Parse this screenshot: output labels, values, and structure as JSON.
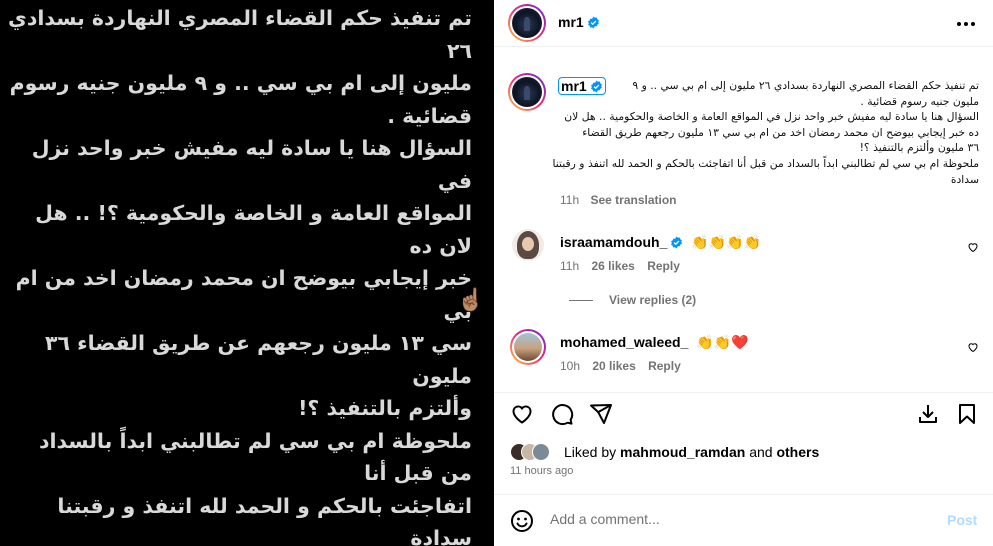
{
  "media": {
    "text": "تم تنفيذ حكم القضاء المصري النهاردة بسدادي ٢٦\nمليون إلى ام بي سي .. و ٩ مليون جنيه رسوم قضائية .\nالسؤال هنا يا سادة ليه مفيش خبر واحد نزل في\nالمواقع العامة و الخاصة والحكومية ؟! .. هل لان ده\nخبر إيجابي بيوضح ان محمد رمضان اخد من ام بي\nسي ١٣ مليون رجعهم عن  طريق القضاء ٣٦ مليون\nوألتزم بالتنفيذ ؟!\nملحوظة ام بي سي لم تطالبني ابداً بالسداد من قبل أنا\nاتفاجئت بالحكم و الحمد لله اتنفذ و رقبتنا سدادة",
    "emoji": "😎 ☝🏽"
  },
  "header": {
    "username": "mr1",
    "more_icon": "more-horizontal-icon"
  },
  "caption": {
    "username": "mr1",
    "text": "تم تنفيذ حكم القضاء المصري النهاردة بسدادي ٢٦ مليون إلى ام بي سي .. و ٩\nمليون جنيه رسوم قضائية .\nالسؤال هنا يا سادة ليه مفيش خبر واحد نزل في المواقع العامة و الخاصة والحكومية .. هل لان\nده خبر إيجابي بيوضح ان محمد رمضان اخد من ام بي سي ١٣ مليون رجعهم طريق القضاء\n٣٦ مليون وألتزم بالتنفيذ ؟!\nملحوظة ام بي سي لم تطالبني ابداً بالسداد من قبل أنا اتفاجئت بالحكم و الحمد لله اتنفذ و رقبتنا سدادة",
    "time": "11h",
    "see_translation": "See translation"
  },
  "comments": [
    {
      "username": "israamamdouh_",
      "text": "👏👏👏👏",
      "time": "11h",
      "likes": "26 likes",
      "reply": "Reply"
    },
    {
      "username": "mohamed_waleed_",
      "text": "👏👏❤️",
      "time": "10h",
      "likes": "20 likes",
      "reply": "Reply"
    }
  ],
  "view_replies": "View replies (2)",
  "likes": {
    "prefix": "Liked by",
    "user": "mahmoud_ramdan",
    "and": "and",
    "others": "others"
  },
  "post_time": "11 hours ago",
  "add_comment": {
    "placeholder": "Add a comment...",
    "post_label": "Post"
  },
  "colors": {
    "link": "#0095f6",
    "post_disabled": "#b3dbff",
    "secondary": "#737373",
    "media_bg": "#000000"
  }
}
